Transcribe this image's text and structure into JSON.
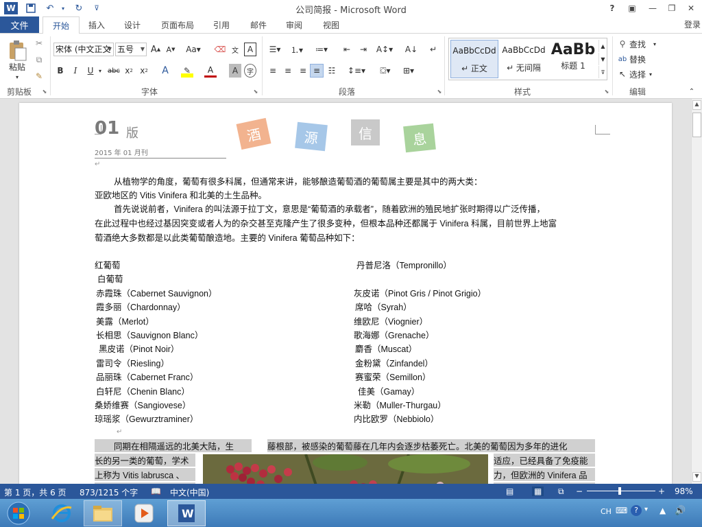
{
  "window": {
    "title": "公司简报 - Microsoft Word",
    "help": "?",
    "login": "登录"
  },
  "tabs": {
    "file": "文件",
    "items": [
      "开始",
      "插入",
      "设计",
      "页面布局",
      "引用",
      "邮件",
      "审阅",
      "视图"
    ]
  },
  "ribbon": {
    "clipboard": {
      "label": "剪贴板",
      "paste": "粘贴"
    },
    "font": {
      "label": "字体",
      "font_name": "宋体 (中文正文",
      "font_size": "五号"
    },
    "paragraph": {
      "label": "段落"
    },
    "styles": {
      "label": "样式",
      "items": [
        {
          "preview": "AaBbCcDd",
          "name": "↵ 正文"
        },
        {
          "preview": "AaBbCcDd",
          "name": "↵ 无间隔"
        },
        {
          "preview": "AaBb",
          "name": "标题 1"
        }
      ]
    },
    "editing": {
      "label": "编辑",
      "find": "查找",
      "replace": "替换",
      "select": "选择"
    }
  },
  "document": {
    "issue": "01",
    "issue_suffix": "版",
    "date": "2015 年 01 月刊",
    "stamps": [
      {
        "char": "酒",
        "color": "#f2b38f"
      },
      {
        "char": "源",
        "color": "#a6c7e8"
      },
      {
        "char": "信",
        "color": "#c9c9c9"
      },
      {
        "char": "息",
        "color": "#a9d39c"
      }
    ],
    "para1_line1": "从植物学的角度，葡萄有很多科属，但通常来讲，能够酿造葡萄酒的葡萄属主要是其中的两大类：",
    "para1_line2": "亚欧地区的 Vitis Vinifera 和北美的土生品种。",
    "para2_line1": "首先说说前者，Vinifera 的叫法源于拉丁文，意思是“葡萄酒的承载者”，随着欧洲的殖民地扩张时期得以广泛传播，",
    "para2_line2": "在此过程中也经过基因突变或者人为的杂交甚至克隆产生了很多变种，但根本品种还都属于 Vinifera 科属，目前世界上地富",
    "para2_line3": "萄酒绝大多数都是以此类葡萄酿造地。主要的 Vinifera 葡萄品种如下：",
    "left_list": [
      "红葡萄",
      "白葡萄",
      "赤霞珠（Cabernet Sauvignon）",
      "霞多丽（Chardonnay）",
      "美露（Merlot）",
      "长相思（Sauvignon Blanc）",
      "黑皮诺（Pinot Noir）",
      "雷司令（Riesling）",
      "品丽珠（Cabernet Franc）",
      "白轩尼（Chenin Blanc）",
      "桑娇维赛（Sangiovese）",
      "琼瑶浆（Gewurztraminer）"
    ],
    "right_list": [
      "丹普尼洛（Tempronillo）",
      "",
      "灰皮诺（Pinot Gris / Pinot Grigio）",
      "席哈（Syrah）",
      "维欧尼（Viognier）",
      "歌海娜（Grenache）",
      "麝香（Muscat）",
      "金粉黛（Zinfandel）",
      "赛蜜荣（Semillon）",
      "佳美（Gamay）",
      "米勒（Muller-Thurgau）",
      "内比欧罗（Nebbiolo）"
    ],
    "para3_line1a": "同期在相隔遥远的北美大陆，生",
    "para3_line1b": "藤根部，被感染的葡萄藤在几年内会逐步枯萎死亡。北美的葡萄因为多年的进化",
    "para3_line2a": "长的另一类的葡萄，学术",
    "para3_line2b": "适应，已经具备了免疫能",
    "para3_line3a": "上称为  Vitis labrusca 、",
    "para3_line3b": "力，但欧洲的 Vinifera 品"
  },
  "status": {
    "page": "第 1 页，共 6 页",
    "words": "873/1215 个字",
    "lang": "中文(中国)",
    "zoom": "98%"
  },
  "tray": {
    "ime": "CH"
  }
}
